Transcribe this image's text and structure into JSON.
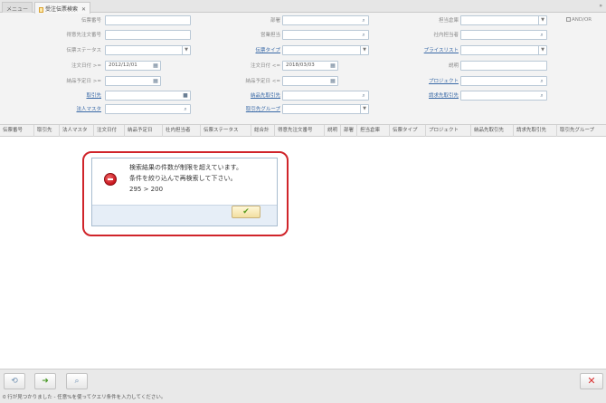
{
  "tabs": [
    {
      "label": "メニュー"
    },
    {
      "label": "受注伝票検索"
    }
  ],
  "form": {
    "andor_label": "AND/OR",
    "slip_no": {
      "label": "伝票番号",
      "value": ""
    },
    "customer_order_no": {
      "label": "得意先注文番号",
      "value": ""
    },
    "slip_status": {
      "label": "伝票ステータス",
      "value": ""
    },
    "order_date_from": {
      "label": "注文日付 >=",
      "value": "2012/12/01"
    },
    "delivery_date_from": {
      "label": "納品予定日 >=",
      "value": ""
    },
    "trade_partner": {
      "label": "取引先",
      "value": ""
    },
    "corporate_master": {
      "label": "法人マスタ",
      "value": ""
    },
    "department": {
      "label": "部署",
      "value": ""
    },
    "sales_staff": {
      "label": "営業担当",
      "value": ""
    },
    "slip_type": {
      "label": "伝票タイプ",
      "value": ""
    },
    "order_date_to": {
      "label": "注文日付 <=",
      "value": "2018/03/03"
    },
    "delivery_date_to": {
      "label": "納品予定日 <=",
      "value": ""
    },
    "delivery_partner": {
      "label": "納品先取引先",
      "value": ""
    },
    "partner_group": {
      "label": "取引先グループ",
      "value": ""
    },
    "warehouse": {
      "label": "担当倉庫",
      "value": ""
    },
    "company_staff": {
      "label": "社内担当者",
      "value": ""
    },
    "price_list": {
      "label": "プライスリスト",
      "value": ""
    },
    "description": {
      "label": "説明",
      "value": ""
    },
    "project": {
      "label": "プロジェクト",
      "value": ""
    },
    "billing_partner": {
      "label": "請求先取引先",
      "value": ""
    }
  },
  "grid": {
    "columns": [
      "伝票番号",
      "取引先",
      "法人マスタ",
      "注文日付",
      "納品予定日",
      "社内担当者",
      "伝票ステータス",
      "総合計",
      "得意先注文番号",
      "説明",
      "部署",
      "担当倉庫",
      "伝票タイプ",
      "プロジェクト",
      "納品先取引先",
      "請求先取引先",
      "取引先グループ"
    ]
  },
  "dialog": {
    "line1": "検索結果の件数が制限を超えています。",
    "line2": "条件を絞り込んで再検索して下さい。",
    "line3": "295 > 200",
    "ok_icon": "checkmark-icon",
    "type_icon": "stop-icon"
  },
  "toolbar": {
    "icons": [
      "clear-icon",
      "search-arrow-icon",
      "preview-icon",
      "close-icon"
    ]
  },
  "status_text": "0 行が見つかりました - 任意%を使ってクエリ条件を入力してください。",
  "colors": {
    "alert_ring": "#d0242a",
    "field_border": "#b9c8d6",
    "link": "#3a6aa7"
  }
}
